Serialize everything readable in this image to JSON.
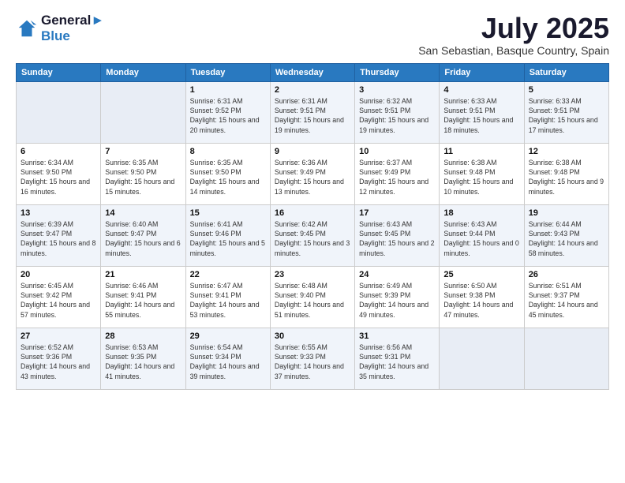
{
  "header": {
    "logo_line1": "General",
    "logo_line2": "Blue",
    "month": "July 2025",
    "location": "San Sebastian, Basque Country, Spain"
  },
  "weekdays": [
    "Sunday",
    "Monday",
    "Tuesday",
    "Wednesday",
    "Thursday",
    "Friday",
    "Saturday"
  ],
  "weeks": [
    [
      {
        "day": "",
        "empty": true
      },
      {
        "day": "",
        "empty": true
      },
      {
        "day": "1",
        "sunrise": "Sunrise: 6:31 AM",
        "sunset": "Sunset: 9:52 PM",
        "daylight": "Daylight: 15 hours and 20 minutes."
      },
      {
        "day": "2",
        "sunrise": "Sunrise: 6:31 AM",
        "sunset": "Sunset: 9:51 PM",
        "daylight": "Daylight: 15 hours and 19 minutes."
      },
      {
        "day": "3",
        "sunrise": "Sunrise: 6:32 AM",
        "sunset": "Sunset: 9:51 PM",
        "daylight": "Daylight: 15 hours and 19 minutes."
      },
      {
        "day": "4",
        "sunrise": "Sunrise: 6:33 AM",
        "sunset": "Sunset: 9:51 PM",
        "daylight": "Daylight: 15 hours and 18 minutes."
      },
      {
        "day": "5",
        "sunrise": "Sunrise: 6:33 AM",
        "sunset": "Sunset: 9:51 PM",
        "daylight": "Daylight: 15 hours and 17 minutes."
      }
    ],
    [
      {
        "day": "6",
        "sunrise": "Sunrise: 6:34 AM",
        "sunset": "Sunset: 9:50 PM",
        "daylight": "Daylight: 15 hours and 16 minutes."
      },
      {
        "day": "7",
        "sunrise": "Sunrise: 6:35 AM",
        "sunset": "Sunset: 9:50 PM",
        "daylight": "Daylight: 15 hours and 15 minutes."
      },
      {
        "day": "8",
        "sunrise": "Sunrise: 6:35 AM",
        "sunset": "Sunset: 9:50 PM",
        "daylight": "Daylight: 15 hours and 14 minutes."
      },
      {
        "day": "9",
        "sunrise": "Sunrise: 6:36 AM",
        "sunset": "Sunset: 9:49 PM",
        "daylight": "Daylight: 15 hours and 13 minutes."
      },
      {
        "day": "10",
        "sunrise": "Sunrise: 6:37 AM",
        "sunset": "Sunset: 9:49 PM",
        "daylight": "Daylight: 15 hours and 12 minutes."
      },
      {
        "day": "11",
        "sunrise": "Sunrise: 6:38 AM",
        "sunset": "Sunset: 9:48 PM",
        "daylight": "Daylight: 15 hours and 10 minutes."
      },
      {
        "day": "12",
        "sunrise": "Sunrise: 6:38 AM",
        "sunset": "Sunset: 9:48 PM",
        "daylight": "Daylight: 15 hours and 9 minutes."
      }
    ],
    [
      {
        "day": "13",
        "sunrise": "Sunrise: 6:39 AM",
        "sunset": "Sunset: 9:47 PM",
        "daylight": "Daylight: 15 hours and 8 minutes."
      },
      {
        "day": "14",
        "sunrise": "Sunrise: 6:40 AM",
        "sunset": "Sunset: 9:47 PM",
        "daylight": "Daylight: 15 hours and 6 minutes."
      },
      {
        "day": "15",
        "sunrise": "Sunrise: 6:41 AM",
        "sunset": "Sunset: 9:46 PM",
        "daylight": "Daylight: 15 hours and 5 minutes."
      },
      {
        "day": "16",
        "sunrise": "Sunrise: 6:42 AM",
        "sunset": "Sunset: 9:45 PM",
        "daylight": "Daylight: 15 hours and 3 minutes."
      },
      {
        "day": "17",
        "sunrise": "Sunrise: 6:43 AM",
        "sunset": "Sunset: 9:45 PM",
        "daylight": "Daylight: 15 hours and 2 minutes."
      },
      {
        "day": "18",
        "sunrise": "Sunrise: 6:43 AM",
        "sunset": "Sunset: 9:44 PM",
        "daylight": "Daylight: 15 hours and 0 minutes."
      },
      {
        "day": "19",
        "sunrise": "Sunrise: 6:44 AM",
        "sunset": "Sunset: 9:43 PM",
        "daylight": "Daylight: 14 hours and 58 minutes."
      }
    ],
    [
      {
        "day": "20",
        "sunrise": "Sunrise: 6:45 AM",
        "sunset": "Sunset: 9:42 PM",
        "daylight": "Daylight: 14 hours and 57 minutes."
      },
      {
        "day": "21",
        "sunrise": "Sunrise: 6:46 AM",
        "sunset": "Sunset: 9:41 PM",
        "daylight": "Daylight: 14 hours and 55 minutes."
      },
      {
        "day": "22",
        "sunrise": "Sunrise: 6:47 AM",
        "sunset": "Sunset: 9:41 PM",
        "daylight": "Daylight: 14 hours and 53 minutes."
      },
      {
        "day": "23",
        "sunrise": "Sunrise: 6:48 AM",
        "sunset": "Sunset: 9:40 PM",
        "daylight": "Daylight: 14 hours and 51 minutes."
      },
      {
        "day": "24",
        "sunrise": "Sunrise: 6:49 AM",
        "sunset": "Sunset: 9:39 PM",
        "daylight": "Daylight: 14 hours and 49 minutes."
      },
      {
        "day": "25",
        "sunrise": "Sunrise: 6:50 AM",
        "sunset": "Sunset: 9:38 PM",
        "daylight": "Daylight: 14 hours and 47 minutes."
      },
      {
        "day": "26",
        "sunrise": "Sunrise: 6:51 AM",
        "sunset": "Sunset: 9:37 PM",
        "daylight": "Daylight: 14 hours and 45 minutes."
      }
    ],
    [
      {
        "day": "27",
        "sunrise": "Sunrise: 6:52 AM",
        "sunset": "Sunset: 9:36 PM",
        "daylight": "Daylight: 14 hours and 43 minutes."
      },
      {
        "day": "28",
        "sunrise": "Sunrise: 6:53 AM",
        "sunset": "Sunset: 9:35 PM",
        "daylight": "Daylight: 14 hours and 41 minutes."
      },
      {
        "day": "29",
        "sunrise": "Sunrise: 6:54 AM",
        "sunset": "Sunset: 9:34 PM",
        "daylight": "Daylight: 14 hours and 39 minutes."
      },
      {
        "day": "30",
        "sunrise": "Sunrise: 6:55 AM",
        "sunset": "Sunset: 9:33 PM",
        "daylight": "Daylight: 14 hours and 37 minutes."
      },
      {
        "day": "31",
        "sunrise": "Sunrise: 6:56 AM",
        "sunset": "Sunset: 9:31 PM",
        "daylight": "Daylight: 14 hours and 35 minutes."
      },
      {
        "day": "",
        "empty": true
      },
      {
        "day": "",
        "empty": true
      }
    ]
  ]
}
